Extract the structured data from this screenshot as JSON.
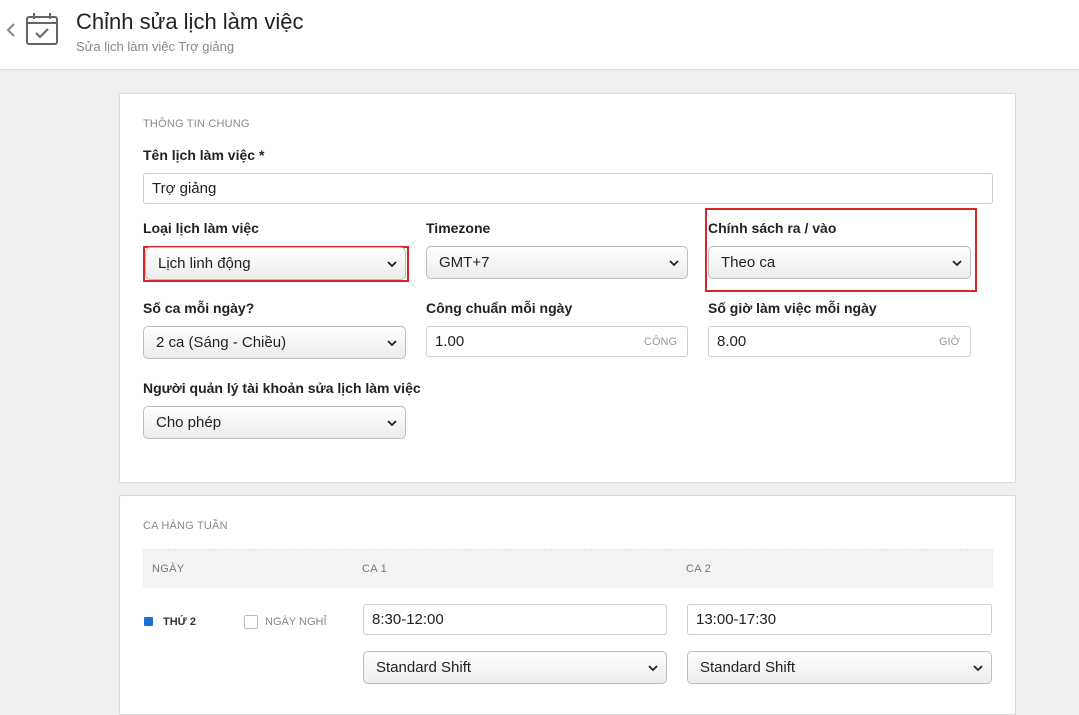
{
  "header": {
    "title": "Chỉnh sửa lịch làm việc",
    "subtitle": "Sửa lịch làm việc Trợ giảng"
  },
  "general": {
    "section_title": "THÔNG TIN CHUNG",
    "name_label": "Tên lịch làm việc *",
    "name_value": "Trợ giảng",
    "type_label": "Loại lịch làm việc",
    "type_value": "Lịch linh động",
    "timezone_label": "Timezone",
    "timezone_value": "GMT+7",
    "policy_label": "Chính sách ra / vào",
    "policy_value": "Theo ca",
    "shifts_label": "Số ca mỗi ngày?",
    "shifts_value": "2 ca (Sáng - Chiều)",
    "workday_label": "Công chuẩn mỗi ngày",
    "workday_value": "1.00",
    "workday_unit": "CÔNG",
    "hours_label": "Số giờ làm việc mỗi ngày",
    "hours_value": "8.00",
    "hours_unit": "GIỜ",
    "manager_label": "Người quản lý tài khoản sửa lịch làm việc",
    "manager_value": "Cho phép"
  },
  "weekly": {
    "section_title": "CA HÀNG TUẦN",
    "columns": [
      "NGÀY",
      "CA 1",
      "CA 2"
    ],
    "rows": [
      {
        "day": "THỨ 2",
        "off_label": "NGÀY NGHỈ",
        "shift1_time": "8:30-12:00",
        "shift1_type": "Standard Shift",
        "shift2_time": "13:00-17:30",
        "shift2_type": "Standard Shift"
      }
    ]
  },
  "colors": {
    "highlight": "#d9262b",
    "day_marker": "#1a6fd8"
  }
}
